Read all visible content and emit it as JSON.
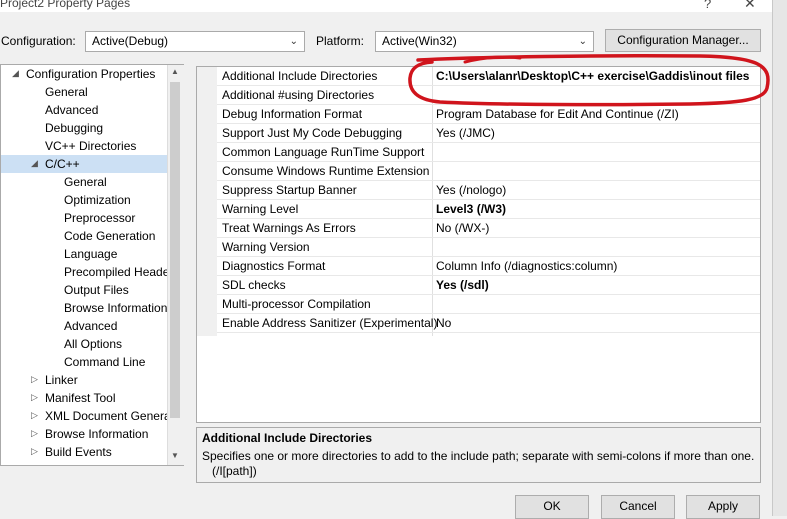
{
  "window": {
    "title": "Project2 Property Pages",
    "help_glyph": "?",
    "close_glyph": "✕"
  },
  "config_bar": {
    "configuration_label": "Configuration:",
    "configuration_value": "Active(Debug)",
    "platform_label": "Platform:",
    "platform_value": "Active(Win32)",
    "manager_button": "Configuration Manager..."
  },
  "tree": {
    "items": [
      {
        "label": "Configuration Properties",
        "expander": "◢"
      },
      {
        "label": "General"
      },
      {
        "label": "Advanced"
      },
      {
        "label": "Debugging"
      },
      {
        "label": "VC++ Directories"
      },
      {
        "label": "C/C++",
        "expander": "◢",
        "selected": true
      },
      {
        "label": "General"
      },
      {
        "label": "Optimization"
      },
      {
        "label": "Preprocessor"
      },
      {
        "label": "Code Generation"
      },
      {
        "label": "Language"
      },
      {
        "label": "Precompiled Heade"
      },
      {
        "label": "Output Files"
      },
      {
        "label": "Browse Information"
      },
      {
        "label": "Advanced"
      },
      {
        "label": "All Options"
      },
      {
        "label": "Command Line"
      },
      {
        "label": "Linker",
        "expander": "▷"
      },
      {
        "label": "Manifest Tool",
        "expander": "▷"
      },
      {
        "label": "XML Document Genera",
        "expander": "▷"
      },
      {
        "label": "Browse Information",
        "expander": "▷"
      },
      {
        "label": "Build Events",
        "expander": "▷"
      }
    ],
    "scroll_up": "▲",
    "scroll_down": "▼"
  },
  "properties": [
    {
      "name": "Additional Include Directories",
      "value": "C:\\Users\\alanr\\Desktop\\C++ exercise\\Gaddis\\inout files",
      "bold": true
    },
    {
      "name": "Additional #using Directories",
      "value": ""
    },
    {
      "name": "Debug Information Format",
      "value": "Program Database for Edit And Continue (/ZI)"
    },
    {
      "name": "Support Just My Code Debugging",
      "value": "Yes (/JMC)"
    },
    {
      "name": "Common Language RunTime Support",
      "value": ""
    },
    {
      "name": "Consume Windows Runtime Extension",
      "value": ""
    },
    {
      "name": "Suppress Startup Banner",
      "value": "Yes (/nologo)"
    },
    {
      "name": "Warning Level",
      "value": "Level3 (/W3)",
      "bold": true
    },
    {
      "name": "Treat Warnings As Errors",
      "value": "No (/WX-)"
    },
    {
      "name": "Warning Version",
      "value": ""
    },
    {
      "name": "Diagnostics Format",
      "value": "Column Info (/diagnostics:column)"
    },
    {
      "name": "SDL checks",
      "value": "Yes (/sdl)",
      "bold": true
    },
    {
      "name": "Multi-processor Compilation",
      "value": ""
    },
    {
      "name": "Enable Address Sanitizer (Experimental)",
      "value": "No"
    }
  ],
  "description": {
    "title": "Additional Include Directories",
    "text": "Specifies one or more directories to add to the include path; separate with semi-colons if more than one.",
    "syntax": "(/I[path])"
  },
  "buttons": {
    "ok": "OK",
    "cancel": "Cancel",
    "apply": "Apply"
  },
  "annotation_color": "#d0141c"
}
